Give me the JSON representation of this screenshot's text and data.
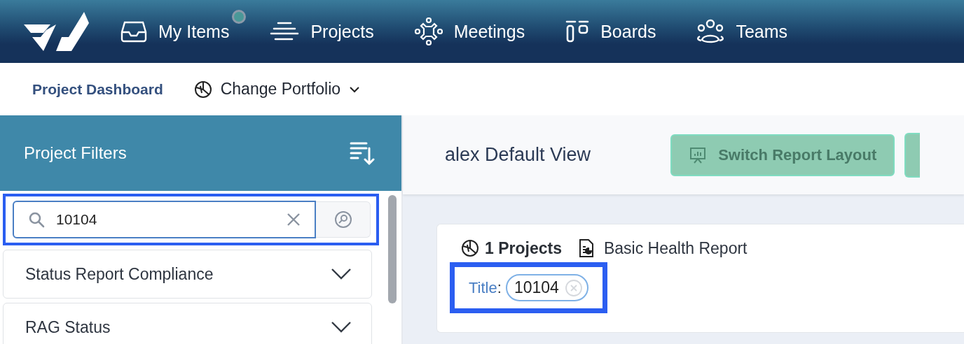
{
  "nav": {
    "items": [
      {
        "label": "My Items",
        "badge": true
      },
      {
        "label": "Projects",
        "badge": false
      },
      {
        "label": "Meetings",
        "badge": false
      },
      {
        "label": "Boards",
        "badge": false
      },
      {
        "label": "Teams",
        "badge": false
      }
    ]
  },
  "subnav": {
    "title": "Project Dashboard",
    "portfolio": "Change Portfolio"
  },
  "sidebar": {
    "title": "Project Filters",
    "search": {
      "value": "10104",
      "highlighted": true
    },
    "filters": [
      {
        "label": "Status Report Compliance",
        "expanded": false
      },
      {
        "label": "RAG Status",
        "expanded": false
      }
    ]
  },
  "main": {
    "view_title": "alex Default View",
    "button": "Switch Report Layout",
    "summary": {
      "count": "1 Projects",
      "report": "Basic Health Report"
    },
    "active_filters": {
      "highlighted": true,
      "items": [
        {
          "field": "Title",
          "separator": ":",
          "value": "10104"
        }
      ]
    }
  }
}
